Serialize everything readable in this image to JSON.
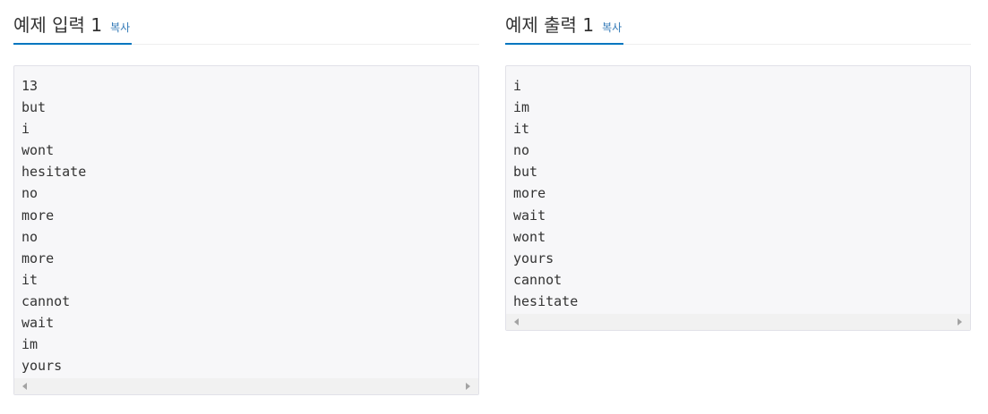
{
  "sample_input": {
    "title": "예제 입력 1",
    "copy_label": "복사",
    "lines": [
      "13",
      "but",
      "i",
      "wont",
      "hesitate",
      "no",
      "more",
      "no",
      "more",
      "it",
      "cannot",
      "wait",
      "im",
      "yours"
    ]
  },
  "sample_output": {
    "title": "예제 출력 1",
    "copy_label": "복사",
    "lines": [
      "i",
      "im",
      "it",
      "no",
      "but",
      "more",
      "wait",
      "wont",
      "yours",
      "cannot",
      "hesitate"
    ]
  },
  "colors": {
    "accent": "#0076c0",
    "link": "#337ab7",
    "code_background": "#f7f7f9",
    "code_border": "#e1e1e8",
    "scrollbar_track": "#f1f1f1"
  },
  "icons": {
    "scroll_left": "scroll-left-arrow-icon",
    "scroll_right": "scroll-right-arrow-icon"
  }
}
